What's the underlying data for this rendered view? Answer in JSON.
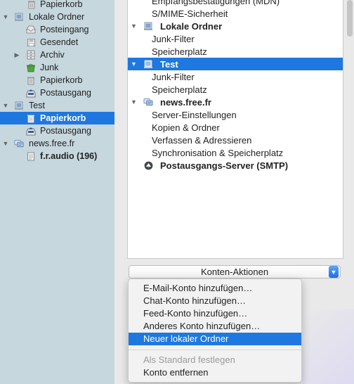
{
  "folder_pane": {
    "items": [
      {
        "label": "Papierkorb",
        "icon": "trash-icon"
      },
      {
        "label": "Lokale Ordner",
        "icon": "local-folders-icon"
      },
      {
        "label": "Posteingang",
        "icon": "inbox-icon"
      },
      {
        "label": "Gesendet",
        "icon": "sent-icon"
      },
      {
        "label": "Archiv",
        "icon": "archive-icon"
      },
      {
        "label": "Junk",
        "icon": "junk-icon"
      },
      {
        "label": "Papierkorb",
        "icon": "trash-icon"
      },
      {
        "label": "Postausgang",
        "icon": "outbox-icon"
      },
      {
        "label": "Test",
        "icon": "local-folders-icon"
      },
      {
        "label": "Papierkorb",
        "icon": "trash-icon"
      },
      {
        "label": "Postausgang",
        "icon": "outbox-icon"
      },
      {
        "label": "news.free.fr",
        "icon": "newsgroup-icon"
      },
      {
        "label": "f.r.audio (196)",
        "icon": "newsgroup-folder-icon"
      }
    ]
  },
  "accounts_tree": {
    "items": [
      {
        "label": "Empfangsbestätigungen (MDN)"
      },
      {
        "label": "S/MIME-Sicherheit"
      },
      {
        "label": "Lokale Ordner",
        "icon": "local-folders-icon"
      },
      {
        "label": "Junk-Filter"
      },
      {
        "label": "Speicherplatz"
      },
      {
        "label": "Test",
        "icon": "local-folders-icon"
      },
      {
        "label": "Junk-Filter"
      },
      {
        "label": "Speicherplatz"
      },
      {
        "label": "news.free.fr",
        "icon": "newsgroup-icon"
      },
      {
        "label": "Server-Einstellungen"
      },
      {
        "label": "Kopien & Ordner"
      },
      {
        "label": "Verfassen & Adressieren"
      },
      {
        "label": "Synchronisation & Speicherplatz"
      },
      {
        "label": "Postausgangs-Server (SMTP)",
        "icon": "smtp-server-icon"
      }
    ]
  },
  "account_actions": {
    "button_label": "Konten-Aktionen",
    "menu_items": [
      {
        "label": "E-Mail-Konto hinzufügen…"
      },
      {
        "label": "Chat-Konto hinzufügen…"
      },
      {
        "label": "Feed-Konto hinzufügen…"
      },
      {
        "label": "Anderes Konto hinzufügen…"
      },
      {
        "label": "Neuer lokaler Ordner"
      },
      {
        "label": "Als Standard festlegen"
      },
      {
        "label": "Konto entfernen"
      }
    ]
  },
  "colors": {
    "selection": "#1f78e0",
    "folder_pane_bg": "#c6d7de",
    "disabled_text": "#9a9a9a"
  }
}
